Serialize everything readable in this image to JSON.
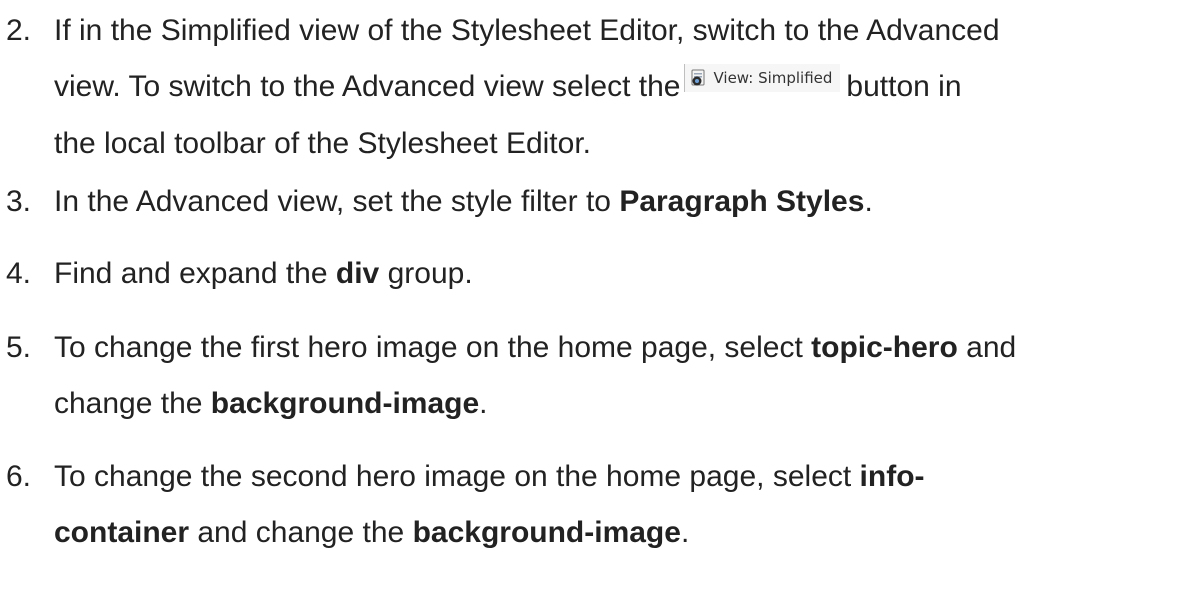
{
  "steps": [
    {
      "number": "2.",
      "line1_before": "If in the Simplified view of the Stylesheet Editor, switch to the Advanced",
      "line2_before": "view. To switch to the Advanced view select the",
      "button_label": "View: Simplified",
      "button_icon": "view-eye-icon",
      "line2_after": "button in",
      "line3": "the local toolbar of the Stylesheet Editor."
    },
    {
      "number": "3.",
      "before": "In the Advanced view, set the style filter to ",
      "bold": "Paragraph Styles",
      "after": "."
    },
    {
      "number": "4.",
      "before": "Find and expand the ",
      "bold": "div",
      "after": " group."
    },
    {
      "number": "5.",
      "line1_before": "To change the first hero image on the home page, select ",
      "line1_bold": "topic-hero",
      "line1_after": " and",
      "line2_before": "change the ",
      "line2_bold": "background-image",
      "line2_after": "."
    },
    {
      "number": "6.",
      "line1_before": "To change the second hero image on the home page, select ",
      "line1_bold": "info-",
      "line2_bold1": "container",
      "line2_mid": " and change the ",
      "line2_bold2": "background-image",
      "line2_after": "."
    }
  ],
  "colors": {
    "text": "#222222",
    "background": "#ffffff"
  }
}
